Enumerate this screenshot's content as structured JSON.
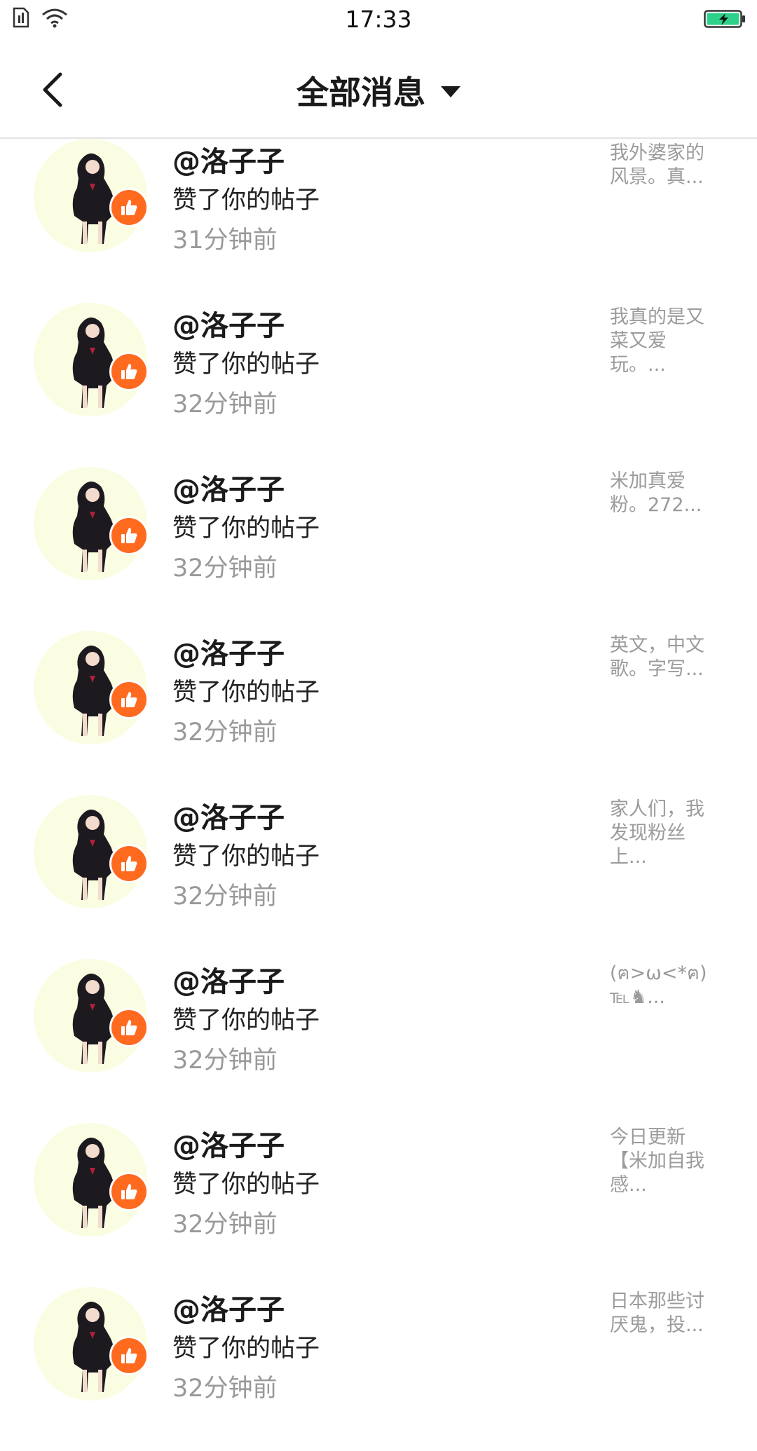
{
  "status_bar": {
    "time": "17:33"
  },
  "header": {
    "title": "全部消息"
  },
  "notifications": [
    {
      "user": "@洛子子",
      "action": "赞了你的帖子",
      "time": "31分钟前",
      "snippet": "我外婆家的风景。真..."
    },
    {
      "user": "@洛子子",
      "action": "赞了你的帖子",
      "time": "32分钟前",
      "snippet": "我真的是又菜又爱玩。..."
    },
    {
      "user": "@洛子子",
      "action": "赞了你的帖子",
      "time": "32分钟前",
      "snippet": "米加真爱粉。272..."
    },
    {
      "user": "@洛子子",
      "action": "赞了你的帖子",
      "time": "32分钟前",
      "snippet": "英文，中文歌。字写..."
    },
    {
      "user": "@洛子子",
      "action": "赞了你的帖子",
      "time": "32分钟前",
      "snippet": "家人们，我发现粉丝上..."
    },
    {
      "user": "@洛子子",
      "action": "赞了你的帖子",
      "time": "32分钟前",
      "snippet": "(ฅ>ω<*ฅ)℡♞..."
    },
    {
      "user": "@洛子子",
      "action": "赞了你的帖子",
      "time": "32分钟前",
      "snippet": "今日更新【米加自我感..."
    },
    {
      "user": "@洛子子",
      "action": "赞了你的帖子",
      "time": "32分钟前",
      "snippet": "日本那些讨厌鬼，投..."
    }
  ],
  "colors": {
    "accent": "#ff6a1f",
    "avatar_bg": "#fbfde2",
    "battery": "#2ed18a"
  },
  "icons": [
    "sim-icon",
    "wifi-icon",
    "battery-charging-icon",
    "back-arrow-icon",
    "dropdown-caret-icon",
    "thumbs-up-icon"
  ]
}
